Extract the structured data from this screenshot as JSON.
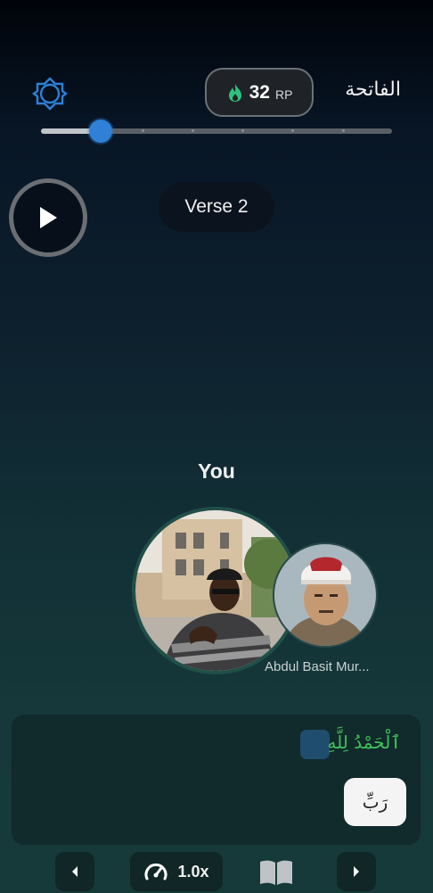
{
  "header": {
    "rp_value": "32",
    "rp_unit": "RP",
    "surah_name": "الفاتحة"
  },
  "playback": {
    "progress": 0.17,
    "verse_label": "Verse 2"
  },
  "participants": {
    "you_label": "You",
    "reciter_name": "Abdul Basit Mur..."
  },
  "recitation": {
    "verse_text": "ٱلْحَمْدُ لِلَّهِ",
    "next_word": "رَبِّ"
  },
  "controls": {
    "speed_label": "1.0x"
  },
  "colors": {
    "accent_blue": "#2f80d6",
    "correct_green": "#3ec25a",
    "flame_green": "#2ec27e"
  },
  "icons": [
    "app-logo-icon",
    "flame-icon",
    "play-icon",
    "chevron-left-icon",
    "speedometer-icon",
    "book-icon",
    "chevron-right-icon"
  ]
}
